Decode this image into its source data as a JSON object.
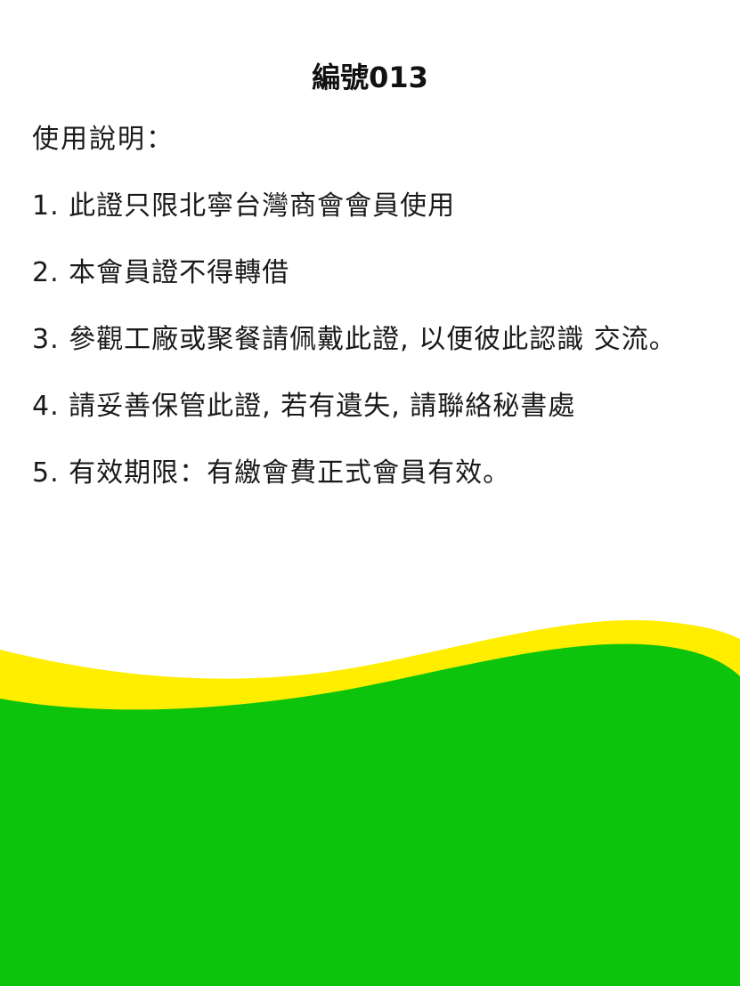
{
  "card": {
    "serial": "編號013",
    "heading": "使用說明：",
    "rules": [
      "1. 此證只限北寧台灣商會會員使用",
      "2. 本會員證不得轉借",
      "3. 參觀工廠或聚餐請佩戴此證, 以便彼此認識 交流。",
      "4. 請妥善保管此證,  若有遺失,  請聯絡秘書處",
      "5. 有效期限：有繳會費正式會員有效。"
    ]
  },
  "colors": {
    "background": "#ffffff",
    "wave_yellow": "#ffee00",
    "wave_green": "#0dc40d",
    "text": "#1a1a1a"
  }
}
